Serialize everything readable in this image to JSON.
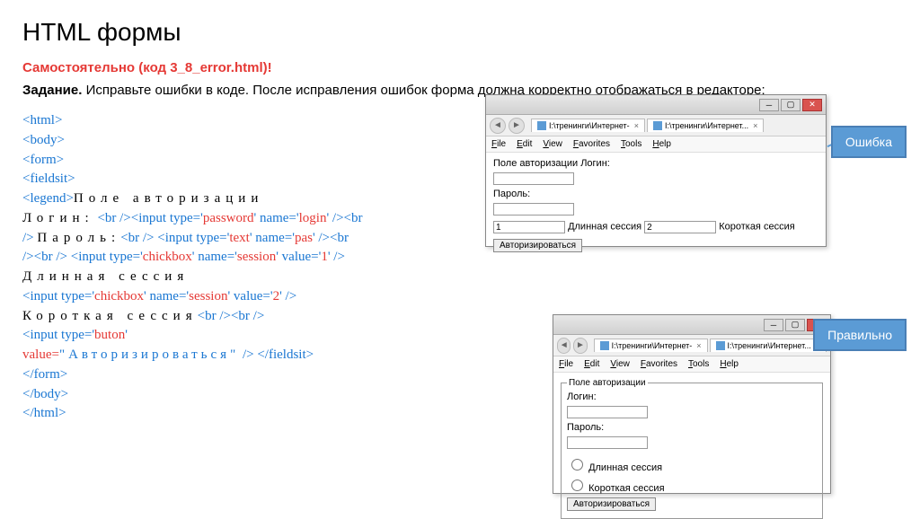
{
  "title": "HTML формы",
  "subtitle": "Самостоятельно (код 3_8_error.html)!",
  "task_label": "Задание.",
  "task_text": " Исправьте ошибки в коде. После исправления ошибок форма должна корректно отображаться в редакторе:",
  "code": {
    "l1": "<html>",
    "l2": "<body>",
    "l3": "<form>",
    "l4": "<fieldsit>",
    "l5a": "<legend>",
    "l5b": "Поле авторизации",
    "l6a": "Логин:",
    "l6b": "<br />",
    "l6c": "<input type='",
    "l6d": "password",
    "l6e": "' name='",
    "l6f": "login",
    "l6g": "' />",
    "l6h": "<br",
    "l7a": "/>",
    "l7b": "Пароль:",
    "l7c": "<br />",
    "l7d": " <input type='",
    "l7e": "text",
    "l7f": "' name='",
    "l7g": "pas",
    "l7h": "' />",
    "l7i": "<br",
    "l8a": "/>",
    "l8b": "<br />",
    "l8c": " <input type='",
    "l8d": "chickbox",
    "l8e": "' name='",
    "l8f": "session",
    "l8g": "' value='",
    "l8h": "1",
    "l8i": "' />",
    "l9": "Длинная сессия",
    "l10a": "<input type='",
    "l10b": "chickbox",
    "l10c": "' name='",
    "l10d": "session",
    "l10e": "' value='",
    "l10f": "2",
    "l10g": "' />",
    "l11a": "Короткая сессия",
    "l11b": "<br />",
    "l11c": "<br />",
    "l12a": "<input type='",
    "l12b": "buton",
    "l12c": "'",
    "l13a": "value=",
    "l13b": "\"Авторизироваться\"",
    "l13c": " />",
    "l13d": " </fieldsit>",
    "l14": "</form>",
    "l15": "</body>",
    "l16": "</html>"
  },
  "browser": {
    "tab_text": "I:\\тренинги\\Интернет-",
    "tab_text2": "I:\\тренинги\\Интернет...",
    "menu": {
      "file": "File",
      "edit": "Edit",
      "view": "View",
      "fav": "Favorites",
      "tools": "Tools",
      "help": "Help"
    }
  },
  "form_error": {
    "heading": "Поле авторизации Логин:",
    "password_label": "Пароль:",
    "val1": "1",
    "long_session": "Длинная сессия",
    "val2": "2",
    "short_session": "Короткая сессия",
    "submit": "Авторизироваться"
  },
  "form_correct": {
    "legend": "Поле авторизации",
    "login_label": "Логин:",
    "password_label": "Пароль:",
    "long_session": "Длинная сессия",
    "short_session": "Короткая сессия",
    "submit": "Авторизироваться"
  },
  "callouts": {
    "error": "Ошибка",
    "correct": "Правильно"
  }
}
